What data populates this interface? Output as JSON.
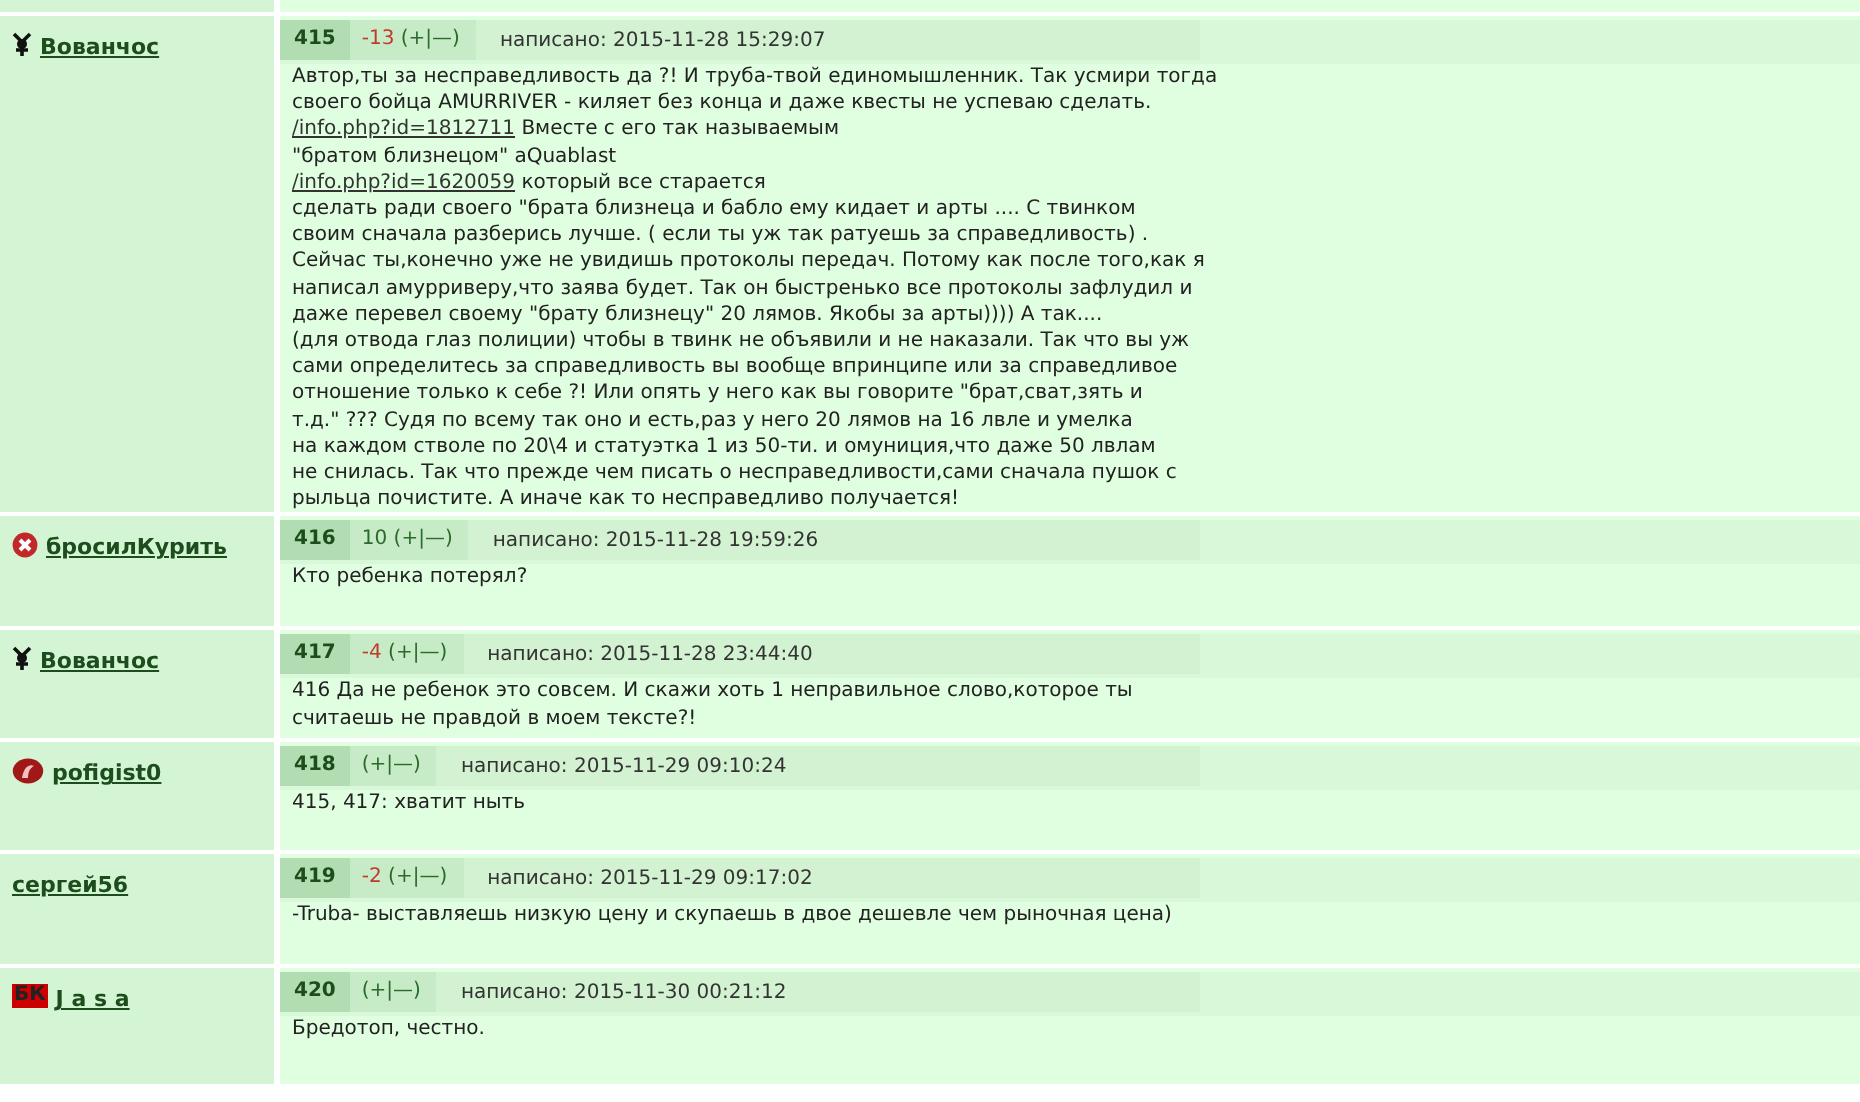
{
  "posts": [
    {
      "author": {
        "name": "Вованчос",
        "kind": "symbol"
      },
      "number": "415",
      "rating": {
        "score": "-13",
        "negative": true
      },
      "vote": "(+|—)",
      "date": "написано: 2015-11-28 15:29:07",
      "body": [
        [
          {
            "kind": "text",
            "text": "Автор,ты за несправедливость да ?! И труба-твой единомышленник. Так усмири тогда"
          }
        ],
        [
          {
            "kind": "text",
            "text": "своего бойца AMURRIVER - киляет без конца и даже квесты не успеваю сделать."
          }
        ],
        [
          {
            "kind": "link",
            "text": "/info.php?id=1812711"
          },
          {
            "kind": "text",
            "text": " Вместе с его так называемым"
          }
        ],
        [
          {
            "kind": "text",
            "text": "\"братом близнецом\" aQuablast"
          }
        ],
        [
          {
            "kind": "link",
            "text": "/info.php?id=1620059"
          },
          {
            "kind": "text",
            "text": " который все старается"
          }
        ],
        [
          {
            "kind": "text",
            "text": "сделать ради своего \"брата близнеца и бабло ему кидает и арты .... С твинком"
          }
        ],
        [
          {
            "kind": "text",
            "text": "своим сначала разберись лучше. ( если ты уж так ратуешь за справедливость) ."
          }
        ],
        [
          {
            "kind": "text",
            "text": "Сейчас ты,конечно уже не увидишь протоколы передач. Потому как после того,как я"
          }
        ],
        [
          {
            "kind": "text",
            "text": "написал амурриверу,что заява будет. Так он быстренько все протоколы зафлудил и"
          }
        ],
        [
          {
            "kind": "text",
            "text": "даже перевел своему \"брату близнецу\" 20 лямов. Якобы за арты)))) А так...."
          }
        ],
        [
          {
            "kind": "text",
            "text": "(для отвода глаз полиции) чтобы в твинк не объявили и не наказали. Так что вы уж"
          }
        ],
        [
          {
            "kind": "text",
            "text": "сами определитесь за справедливость вы вообще впринципе или за справедливое"
          }
        ],
        [
          {
            "kind": "text",
            "text": "отношение только к себе ?! Или опять у него как вы говорите \"брат,сват,зять и"
          }
        ],
        [
          {
            "kind": "text",
            "text": "т.д.\" ??? Судя по всему так оно и есть,раз у него 20 лямов на 16 лвле и умелка"
          }
        ],
        [
          {
            "kind": "text",
            "text": "на каждом стволе по 20\\4 и статуэтка 1 из 50-ти. и омуниция,что даже 50 лвлам"
          }
        ],
        [
          {
            "kind": "text",
            "text": "не снилась. Так что прежде чем писать о несправедливости,сами сначала пушок с"
          }
        ],
        [
          {
            "kind": "text",
            "text": "рыльца почистите. А иначе как то несправедливо получается!"
          }
        ]
      ]
    },
    {
      "author": {
        "name": "бросилКурить",
        "kind": "cross"
      },
      "number": "416",
      "rating": {
        "score": "10",
        "negative": false
      },
      "vote": "(+|—)",
      "date": "написано: 2015-11-28 19:59:26",
      "body": [
        [
          {
            "kind": "text",
            "text": "Кто ребенка потерял?"
          }
        ]
      ]
    },
    {
      "author": {
        "name": "Вованчос",
        "kind": "symbol"
      },
      "number": "417",
      "rating": {
        "score": "-4",
        "negative": true
      },
      "vote": "(+|—)",
      "date": "написано: 2015-11-28 23:44:40",
      "body": [
        [
          {
            "kind": "text",
            "text": "416 Да не ребенок это совсем. И скажи хоть 1 неправильное слово,которое ты"
          }
        ],
        [
          {
            "kind": "text",
            "text": "считаешь не правдой в моем тексте?!"
          }
        ]
      ]
    },
    {
      "author": {
        "name": "pofigist0",
        "kind": "emblem"
      },
      "number": "418",
      "vote": "(+|—)",
      "date": "написано: 2015-11-29 09:10:24",
      "body": [
        [
          {
            "kind": "text",
            "text": "415, 417: хватит ныть"
          }
        ]
      ]
    },
    {
      "author": {
        "name": "сергей56"
      },
      "number": "419",
      "rating": {
        "score": "-2",
        "negative": true
      },
      "vote": "(+|—)",
      "date": "написано: 2015-11-29 09:17:02",
      "body": [
        [
          {
            "kind": "text",
            "text": "-Truba- выставляешь низкую цену и скупаешь в двое дешевле чем рыночная цена)"
          }
        ]
      ]
    },
    {
      "author": {
        "name": "J a s a",
        "kind": "badge",
        "badge": "БК"
      },
      "number": "420",
      "vote": "(+|—)",
      "date": "написано: 2015-11-30 00:21:12",
      "body": [
        [
          {
            "kind": "text",
            "text": "Бредотоп, честно."
          }
        ]
      ]
    }
  ]
}
